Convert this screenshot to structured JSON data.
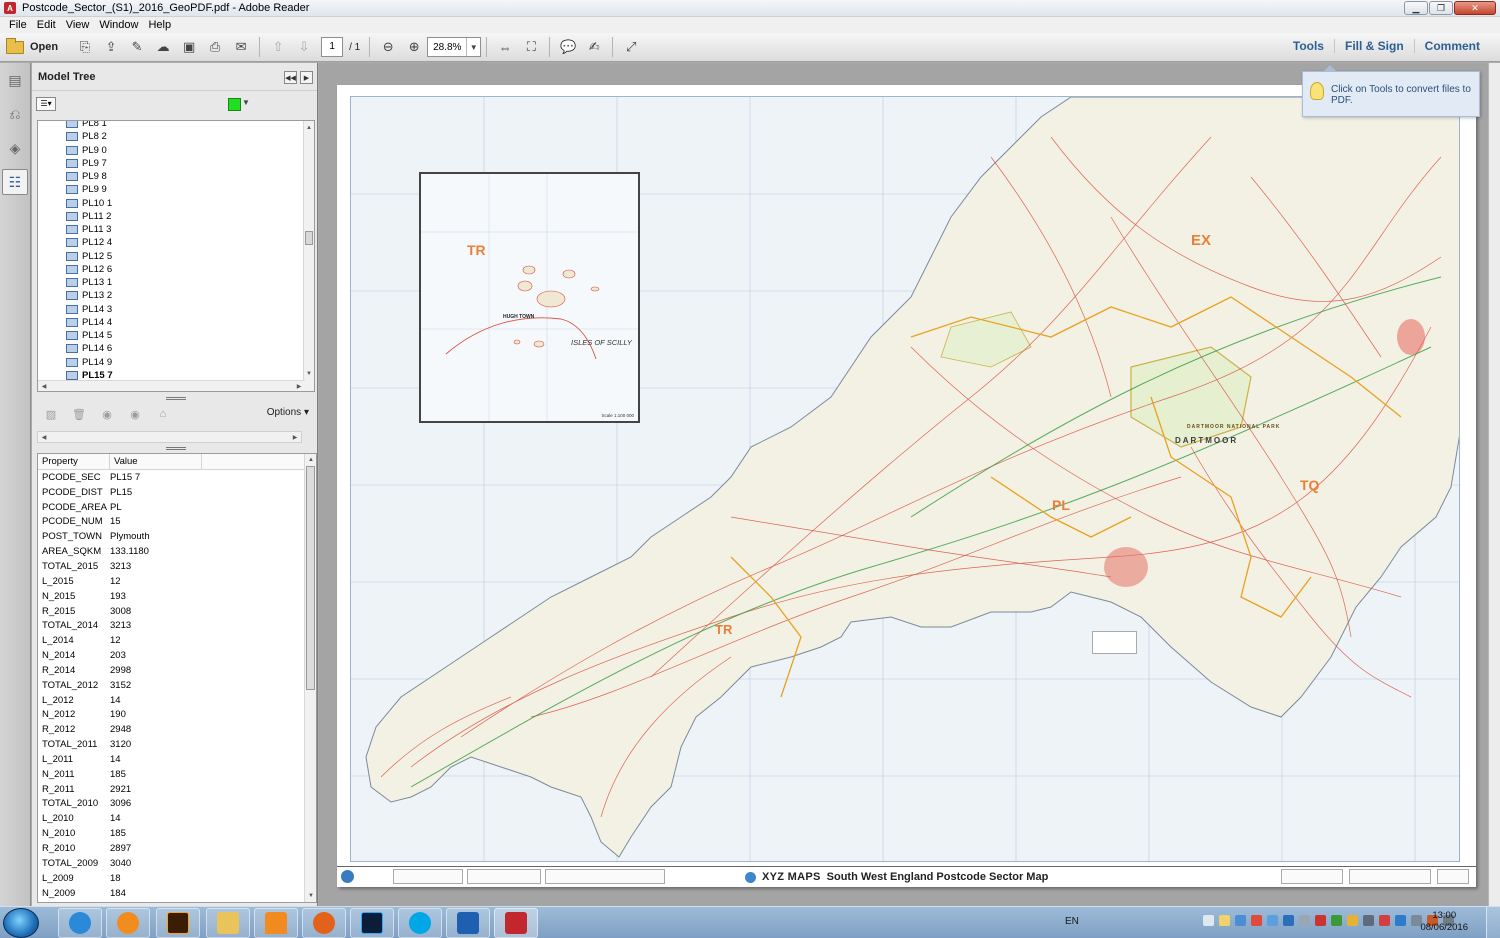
{
  "window": {
    "title": "Postcode_Sector_(S1)_2016_GeoPDF.pdf - Adobe Reader",
    "minimize": "▁",
    "maximize": "❐",
    "close": "✕"
  },
  "menu": [
    "File",
    "Edit",
    "View",
    "Window",
    "Help"
  ],
  "toolbar": {
    "open_label": "Open",
    "current_page": "1",
    "page_total": "/ 1",
    "zoom": "28.8%",
    "right_links": [
      "Tools",
      "Fill & Sign",
      "Comment"
    ]
  },
  "nav_panel": {
    "title": "Model Tree",
    "layer_color": "#22dd22",
    "tree_items": [
      "PL8 1",
      "PL8 2",
      "PL9 0",
      "PL9 7",
      "PL9 8",
      "PL9 9",
      "PL10 1",
      "PL11 2",
      "PL11 3",
      "PL12 4",
      "PL12 5",
      "PL12 6",
      "PL13 1",
      "PL13 2",
      "PL14 3",
      "PL14 4",
      "PL14 5",
      "PL14 6",
      "PL14 9",
      "PL15 7"
    ],
    "selected_item": "PL15 7",
    "options_label": "Options",
    "properties_header": {
      "property": "Property",
      "value": "Value"
    },
    "properties": [
      [
        "PCODE_SEC",
        "PL15 7"
      ],
      [
        "PCODE_DIST",
        "PL15"
      ],
      [
        "PCODE_AREA",
        "PL"
      ],
      [
        "PCODE_NUM",
        "15"
      ],
      [
        "POST_TOWN",
        "Plymouth"
      ],
      [
        "AREA_SQKM",
        "133.1180"
      ],
      [
        "TOTAL_2015",
        "3213"
      ],
      [
        "L_2015",
        "12"
      ],
      [
        "N_2015",
        "193"
      ],
      [
        "R_2015",
        "3008"
      ],
      [
        "TOTAL_2014",
        "3213"
      ],
      [
        "L_2014",
        "12"
      ],
      [
        "N_2014",
        "203"
      ],
      [
        "R_2014",
        "2998"
      ],
      [
        "TOTAL_2012",
        "3152"
      ],
      [
        "L_2012",
        "14"
      ],
      [
        "N_2012",
        "190"
      ],
      [
        "R_2012",
        "2948"
      ],
      [
        "TOTAL_2011",
        "3120"
      ],
      [
        "L_2011",
        "14"
      ],
      [
        "N_2011",
        "185"
      ],
      [
        "R_2011",
        "2921"
      ],
      [
        "TOTAL_2010",
        "3096"
      ],
      [
        "L_2010",
        "14"
      ],
      [
        "N_2010",
        "185"
      ],
      [
        "R_2010",
        "2897"
      ],
      [
        "TOTAL_2009",
        "3040"
      ],
      [
        "L_2009",
        "18"
      ],
      [
        "N_2009",
        "184"
      ]
    ]
  },
  "document": {
    "inset": {
      "area_code": "TR",
      "islands_label": "ISLES OF SCILLY",
      "town_label": "HUGH TOWN",
      "scale_label": "Scale 1:100 000"
    },
    "map_area_codes": [
      "EX",
      "PL",
      "TQ",
      "TR"
    ],
    "dartmoor_label": "DARTMOOR",
    "national_park_label": "DARTMOOR NATIONAL PARK",
    "footer_brand": "XYZ MAPS",
    "footer_title": "South West England Postcode Sector Map",
    "tooltip": "Click on Tools to convert files to PDF."
  },
  "taskbar": {
    "language": "EN",
    "time": "13:00",
    "date": "08/06/2016"
  }
}
